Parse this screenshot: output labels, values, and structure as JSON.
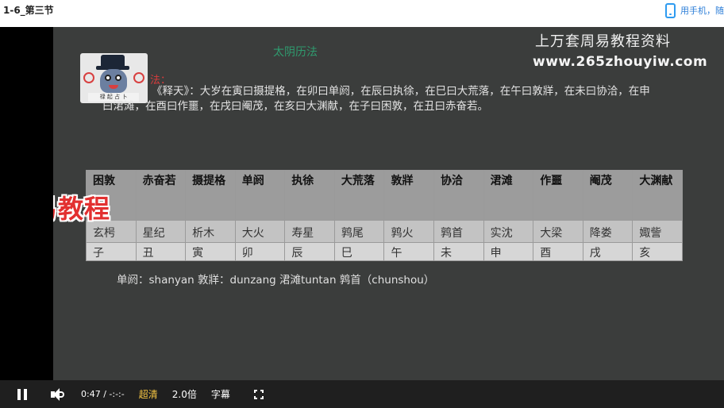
{
  "page": {
    "title": "1-6_第三节",
    "mobile_link": "用手机，随"
  },
  "slide": {
    "heading": "太阴历法",
    "watermark_line1": "上万套周易教程资料",
    "watermark_line2": "www.265zhouyiw.com",
    "red_label": "法：",
    "paragraph": "《释天》：大岁在寅曰摄提格，在卯曰单阏，在辰曰执徐，在巳曰大荒落，在午曰敦牂，在未曰协洽，在申曰涒滩，在酉曰作噩，在戌曰阉茂，在亥曰大渊献，在子曰困敦，在丑曰赤奋若。",
    "brand": "九易教程",
    "pinyin_note": "单阏：shanyan  敦牂：dunzang  涒滩tuntan  鹑首（chunshou）",
    "table": {
      "headers": [
        "困敦",
        "赤奋若",
        "摄提格",
        "单阏",
        "执徐",
        "大荒落",
        "敦牂",
        "协洽",
        "涒滩",
        "作噩",
        "阉茂",
        "大渊献"
      ],
      "row1": [
        "玄枵",
        "星纪",
        "析木",
        "大火",
        "寿星",
        "鹑尾",
        "鹑火",
        "鹑首",
        "实沈",
        "大梁",
        "降娄",
        "娵訾"
      ],
      "row2": [
        "子",
        "丑",
        "寅",
        "卯",
        "辰",
        "巳",
        "午",
        "未",
        "申",
        "酉",
        "戌",
        "亥"
      ]
    }
  },
  "controls": {
    "pause_icon": "pause-icon",
    "volume_icon": "volume-icon",
    "time": "0:47 / -:-:-",
    "quality": "超清",
    "speed": "2.0倍",
    "subtitles": "字幕",
    "fullscreen_icon": "fullscreen-icon",
    "quality_color": "#f5c542"
  }
}
